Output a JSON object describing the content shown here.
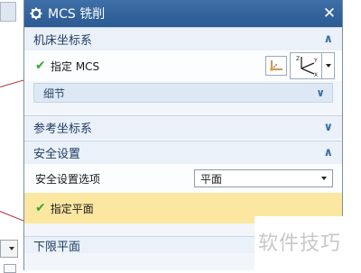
{
  "dialog": {
    "title": "MCS 铣削",
    "close_glyph": "✕"
  },
  "sections": {
    "machine_csys": {
      "label": "机床坐标系",
      "expanded": true,
      "specify_label": "指定 MCS",
      "details_label": "细节"
    },
    "reference_csys": {
      "label": "参考坐标系",
      "expanded": false
    },
    "clearance": {
      "label": "安全设置",
      "expanded": true,
      "option_label": "安全设置选项",
      "option_value": "平面",
      "specify_plane_label": "指定平面"
    },
    "lower_limit": {
      "label": "下限平面"
    }
  },
  "icons": {
    "chevron_up": "∧",
    "chevron_down": "∨",
    "check": "✔"
  },
  "watermark": "软件技巧",
  "colors": {
    "title_bar": "#3f6fa8",
    "highlight_row": "#fbe7a0",
    "check_green": "#3aa53a",
    "chevron_blue": "#3a6ea5"
  }
}
